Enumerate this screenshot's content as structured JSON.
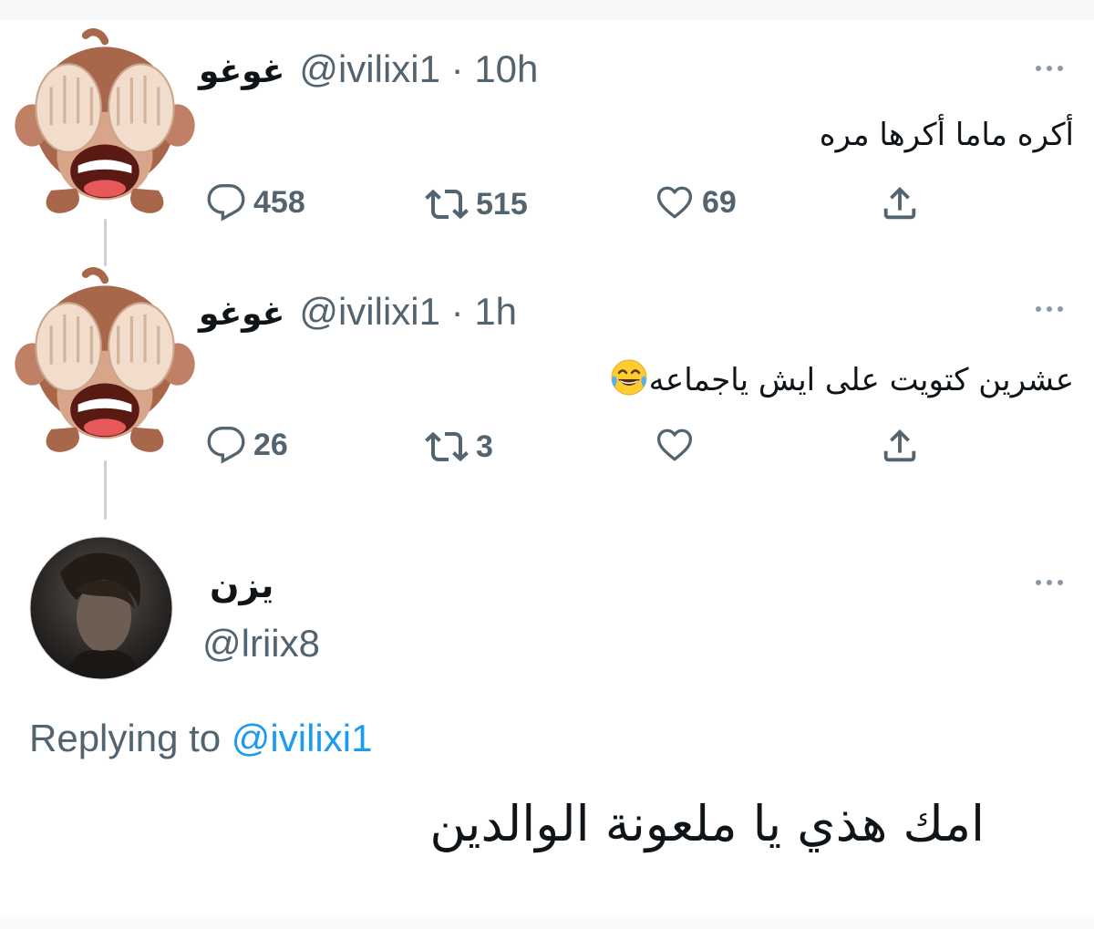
{
  "tweets": [
    {
      "display_name": "غوغو",
      "handle": "@ivilixi1",
      "separator": "·",
      "time": "10h",
      "text": "أكره ماما أكرها مره",
      "text_emoji": "",
      "replies": "458",
      "retweets": "515",
      "likes": "69",
      "avatar_icon": "see-no-evil-monkey-icon"
    },
    {
      "display_name": "غوغو",
      "handle": "@ivilixi1",
      "separator": "·",
      "time": "1h",
      "text": "عشرين كتويت على ايش ياجماعه",
      "text_emoji": "face-with-tears-of-joy-icon",
      "replies": "26",
      "retweets": "3",
      "likes": "",
      "avatar_icon": "see-no-evil-monkey-icon"
    }
  ],
  "reply": {
    "display_name": "يزن",
    "handle": "@lriix8",
    "replying_label": "Replying to",
    "replying_handle": "@ivilixi1",
    "text": "امك هذي يا ملعونة الوالدين",
    "avatar_icon": "profile-photo"
  },
  "colors": {
    "text_primary": "#0f1419",
    "text_secondary": "#536471",
    "mention": "#1d9bf0",
    "thread_line": "#c9d1d8"
  },
  "icons": [
    "reply-icon",
    "retweet-icon",
    "like-icon",
    "share-icon",
    "more-icon"
  ]
}
